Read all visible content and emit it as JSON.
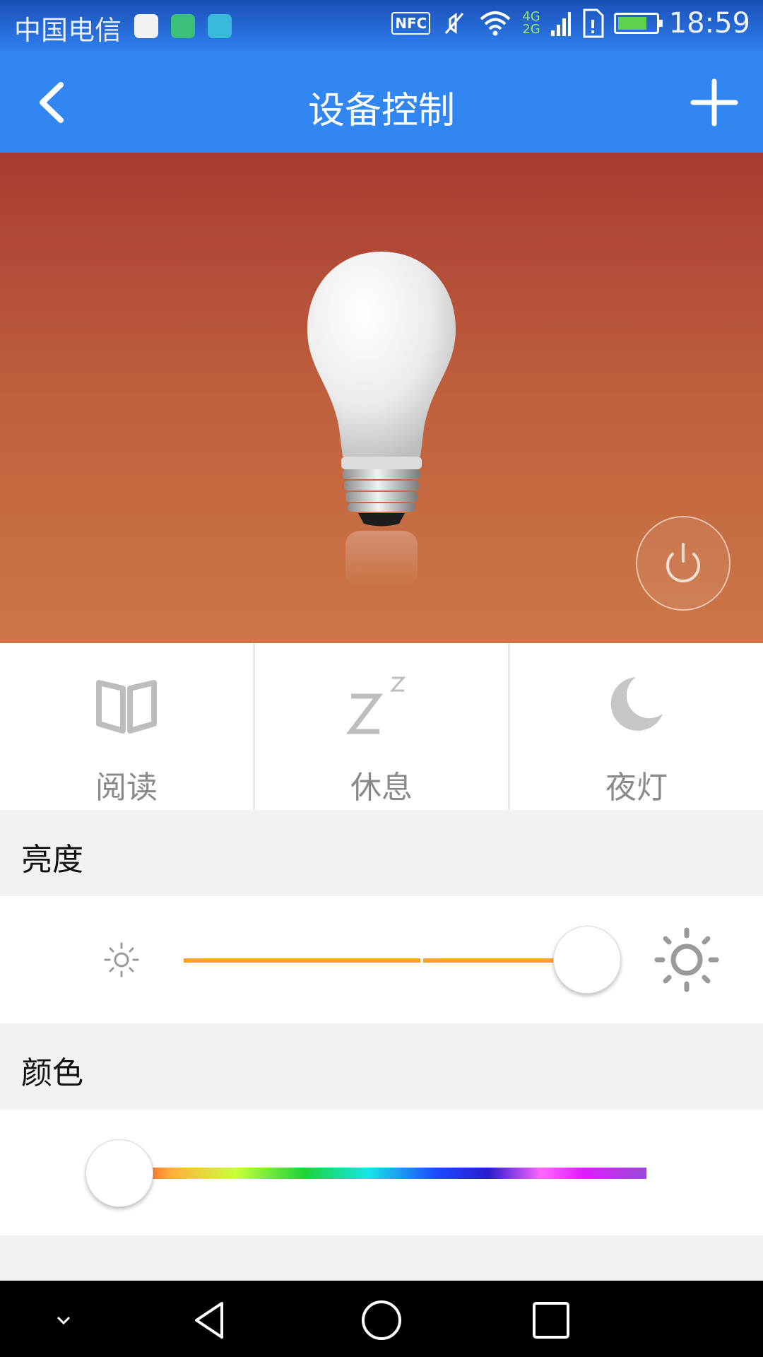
{
  "status_bar": {
    "carrier": "中国电信",
    "nfc": "NFC",
    "network_top": "4G",
    "network_bottom": "2G",
    "time": "18:59"
  },
  "app_bar": {
    "title": "设备控制",
    "back_icon": "chevron-left-icon",
    "add_icon": "plus-icon"
  },
  "device": {
    "image": "light-bulb",
    "power_icon": "power-icon"
  },
  "modes": [
    {
      "label": "阅读",
      "icon": "book-icon"
    },
    {
      "label": "休息",
      "icon": "sleep-zz-icon"
    },
    {
      "label": "夜灯",
      "icon": "moon-icon"
    }
  ],
  "brightness": {
    "title": "亮度",
    "level": 0.91,
    "accent": "#f5a12c"
  },
  "color": {
    "title": "颜色",
    "hue_position": 0.0
  },
  "colors": {
    "app_bar": "#3286f2",
    "hero_top": "#a63c33",
    "hero_bottom": "#cc7747"
  }
}
